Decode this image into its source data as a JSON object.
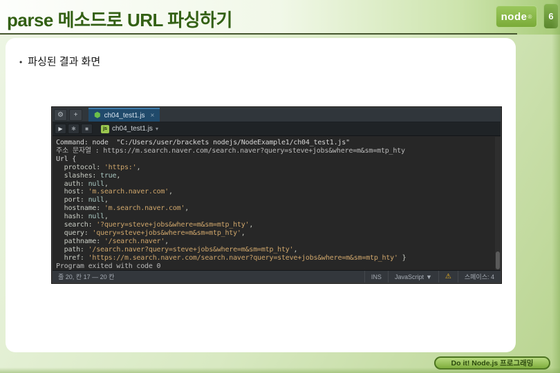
{
  "slide": {
    "title": "parse 메소드로 URL 파싱하기",
    "page_number": "6",
    "bullet_marker": "•",
    "bullet": "파싱된 결과 화면",
    "logo_text": "node",
    "logo_reg": "®",
    "footer_badge": "Do it! Node.js 프로그래밍"
  },
  "colors": {
    "title_green": "#336014",
    "badge_green": "#7aab39",
    "pill_border": "#4b731f",
    "tab_blue": "#204a6b",
    "warning_yellow": "#f5b81c"
  },
  "screenshot": {
    "toolbar": {
      "gear_icon": "⚙",
      "plus_icon": "+",
      "tab_hex_icon": "⬢",
      "tab_label": "ch04_test1.js",
      "tab_close": "×",
      "run_icon": "▶",
      "debug_icon": "✱",
      "stop_icon": "■",
      "js_badge": "js",
      "file_label": "ch04_test1.js",
      "file_caret": "▾"
    },
    "console": {
      "lines": [
        [
          {
            "t": "Command: node  \"C:/Users/user/brackets nodejs/NodeExample1/ch04_test1.js\"",
            "c": "plain"
          }
        ],
        [
          {
            "t": "주소 문자열 : https://m.search.naver.com/search.naver?query=steve+jobs&where=m&sm=mtp_hty",
            "c": "dim"
          }
        ],
        [
          {
            "t": "Url {",
            "c": "plain"
          }
        ],
        [
          {
            "t": "  protocol: ",
            "c": "key"
          },
          {
            "t": "'https:'",
            "c": "str"
          },
          {
            "t": ",",
            "c": "key"
          }
        ],
        [
          {
            "t": "  slashes: ",
            "c": "key"
          },
          {
            "t": "true",
            "c": "bool"
          },
          {
            "t": ",",
            "c": "key"
          }
        ],
        [
          {
            "t": "  auth: ",
            "c": "key"
          },
          {
            "t": "null",
            "c": "bool"
          },
          {
            "t": ",",
            "c": "key"
          }
        ],
        [
          {
            "t": "  host: ",
            "c": "key"
          },
          {
            "t": "'m.search.naver.com'",
            "c": "str"
          },
          {
            "t": ",",
            "c": "key"
          }
        ],
        [
          {
            "t": "  port: ",
            "c": "key"
          },
          {
            "t": "null",
            "c": "bool"
          },
          {
            "t": ",",
            "c": "key"
          }
        ],
        [
          {
            "t": "  hostname: ",
            "c": "key"
          },
          {
            "t": "'m.search.naver.com'",
            "c": "str"
          },
          {
            "t": ",",
            "c": "key"
          }
        ],
        [
          {
            "t": "  hash: ",
            "c": "key"
          },
          {
            "t": "null",
            "c": "bool"
          },
          {
            "t": ",",
            "c": "key"
          }
        ],
        [
          {
            "t": "  search: ",
            "c": "key"
          },
          {
            "t": "'?query=steve+jobs&where=m&sm=mtp_hty'",
            "c": "str"
          },
          {
            "t": ",",
            "c": "key"
          }
        ],
        [
          {
            "t": "  query: ",
            "c": "key"
          },
          {
            "t": "'query=steve+jobs&where=m&sm=mtp_hty'",
            "c": "str"
          },
          {
            "t": ",",
            "c": "key"
          }
        ],
        [
          {
            "t": "  pathname: ",
            "c": "key"
          },
          {
            "t": "'/search.naver'",
            "c": "str"
          },
          {
            "t": ",",
            "c": "key"
          }
        ],
        [
          {
            "t": "  path: ",
            "c": "key"
          },
          {
            "t": "'/search.naver?query=steve+jobs&where=m&sm=mtp_hty'",
            "c": "str"
          },
          {
            "t": ",",
            "c": "key"
          }
        ],
        [
          {
            "t": "  href: ",
            "c": "key"
          },
          {
            "t": "'https://m.search.naver.com/search.naver?query=steve+jobs&where=m&sm=mtp_hty'",
            "c": "str"
          },
          {
            "t": " }",
            "c": "key"
          }
        ],
        [
          {
            "t": "Program exited with code 0",
            "c": "dim"
          }
        ]
      ]
    },
    "statusbar": {
      "left": "줄 20, 칸 17 — 20 칸",
      "ins": "INS",
      "language": "JavaScript",
      "caret": "▼",
      "warning_icon": "⚠",
      "spaces": "스페이스: 4"
    }
  }
}
